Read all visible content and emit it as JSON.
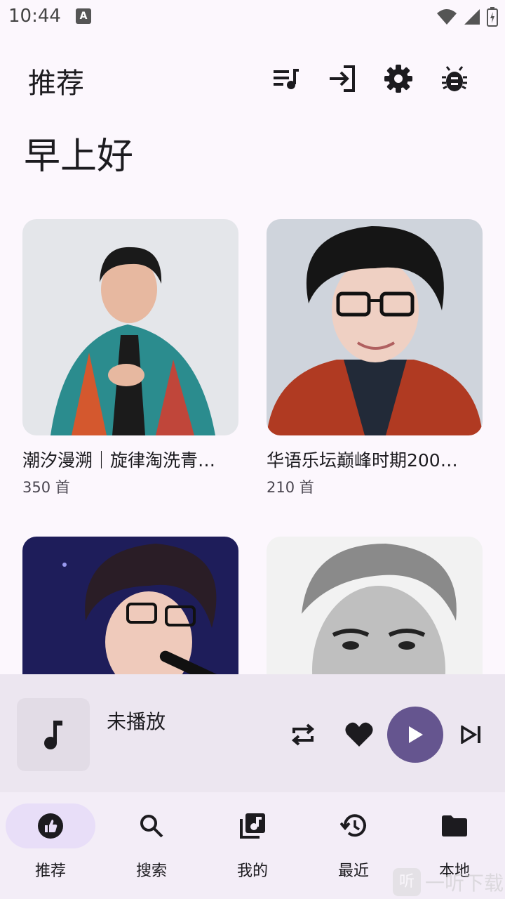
{
  "status_bar": {
    "time": "10:44",
    "notification_badge": "A"
  },
  "header": {
    "title": "推荐"
  },
  "greeting": "早上好",
  "playlists": [
    {
      "title": "潮汐漫溯｜旋律淘洗青…",
      "count": "350 首"
    },
    {
      "title": "华语乐坛巅峰时期200…",
      "count": "210 首"
    },
    {
      "title": "",
      "count": ""
    },
    {
      "title": "",
      "count": ""
    }
  ],
  "player": {
    "song": "未播放"
  },
  "nav": [
    {
      "label": "推荐",
      "icon": "thumb-up-icon",
      "active": true
    },
    {
      "label": "搜索",
      "icon": "search-icon",
      "active": false
    },
    {
      "label": "我的",
      "icon": "library-music-icon",
      "active": false
    },
    {
      "label": "最近",
      "icon": "history-icon",
      "active": false
    },
    {
      "label": "本地",
      "icon": "folder-icon",
      "active": false
    }
  ],
  "watermark": {
    "icon_text": "听",
    "text": "一听下载"
  },
  "colors": {
    "background": "#fcf7fd",
    "accent": "#65558f",
    "nav_active": "#e8def8",
    "player_bg": "#ece6f0"
  }
}
